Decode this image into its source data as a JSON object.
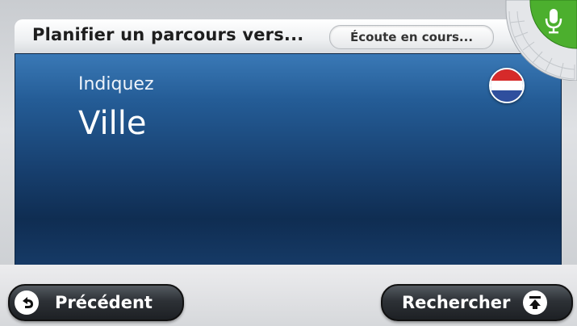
{
  "header": {
    "title": "Planifier un parcours vers...",
    "status": "Écoute en cours..."
  },
  "main": {
    "prompt": "Indiquez",
    "field": "Ville",
    "country_flag": "netherlands-flag-icon"
  },
  "voice": {
    "icon": "microphone-icon",
    "active_color": "#4caf2e"
  },
  "footer": {
    "back_label": "Précédent",
    "back_icon": "back-arrow-icon",
    "search_label": "Rechercher",
    "search_icon": "search-up-icon"
  },
  "colors": {
    "panel_blue": "#173f6e",
    "button_dark": "#2d3136"
  }
}
